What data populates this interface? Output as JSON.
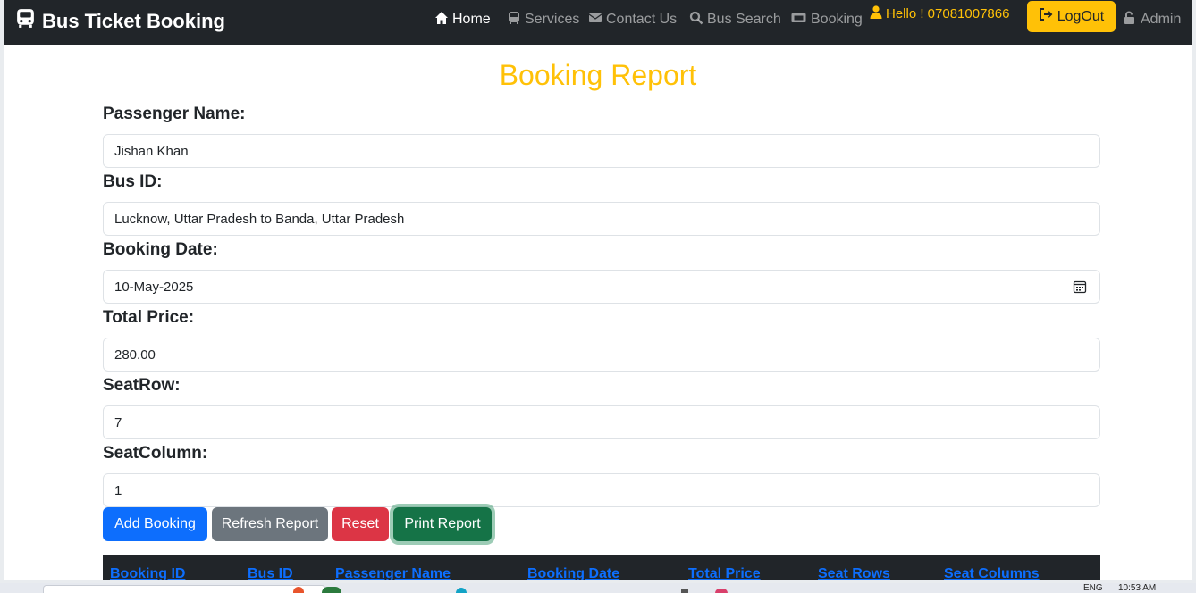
{
  "navbar": {
    "brand": "Bus Ticket Booking",
    "links": {
      "home": "Home",
      "services": "Services",
      "contact": "Contact Us",
      "bus_search": "Bus Search",
      "booking": "Booking"
    },
    "greeting": "Hello ! 07081007866",
    "logout": "LogOut",
    "admin": "Admin"
  },
  "page": {
    "title": "Booking Report"
  },
  "form": {
    "passenger_label": "Passenger Name:",
    "passenger_value": "Jishan Khan",
    "bus_label": "Bus ID:",
    "bus_value": "Lucknow, Uttar Pradesh to Banda, Uttar Pradesh",
    "date_label": "Booking Date:",
    "date_value": "10-May-2025",
    "price_label": "Total Price:",
    "price_value": "280.00",
    "seatrow_label": "SeatRow:",
    "seatrow_value": "7",
    "seatcol_label": "SeatColumn:",
    "seatcol_value": "1"
  },
  "buttons": {
    "add": "Add Booking",
    "refresh": "Refresh Report",
    "reset": "Reset",
    "print": "Print Report"
  },
  "table": {
    "columns": [
      "Booking ID",
      "Bus ID",
      "Passenger Name",
      "Booking Date",
      "Total Price",
      "Seat Rows",
      "Seat Columns"
    ]
  },
  "taskbar": {
    "lang": "ENG",
    "time": "10:53 AM"
  },
  "colors": {
    "accent": "#ffc107",
    "navbar": "#212529",
    "primary": "#0d6efd",
    "success": "#157347",
    "danger": "#dc3545",
    "secondary": "#6c757d"
  }
}
